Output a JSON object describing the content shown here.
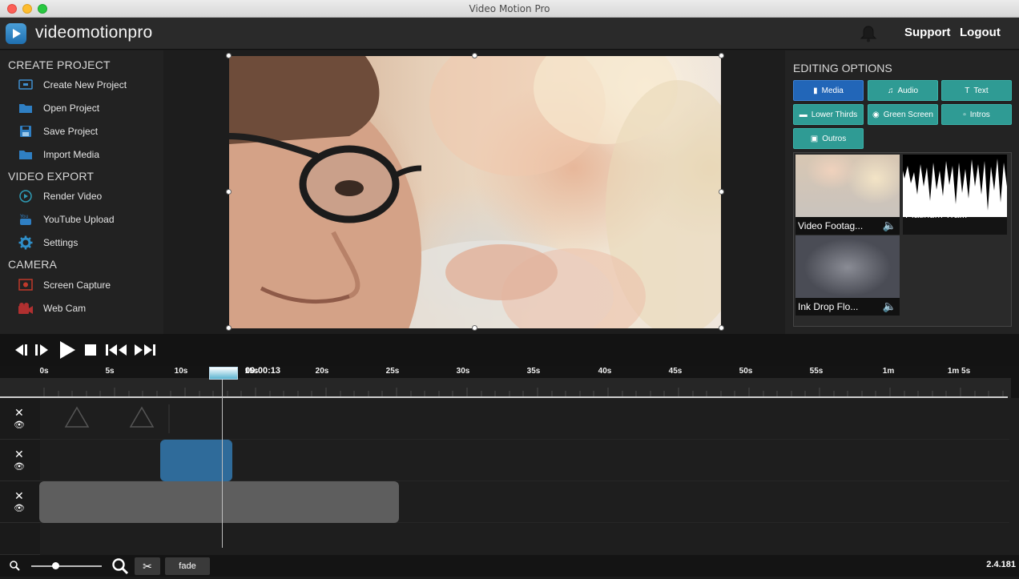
{
  "window": {
    "title": "Video Motion Pro"
  },
  "app": {
    "brand": "videomotionpro",
    "support_label": "Support",
    "logout_label": "Logout"
  },
  "sidebar": {
    "create_title": "CREATE PROJECT",
    "export_title": "VIDEO EXPORT",
    "camera_title": "CAMERA",
    "items": [
      {
        "label": "Create New Project",
        "icon": "new-project-icon"
      },
      {
        "label": "Open Project",
        "icon": "folder-open-icon"
      },
      {
        "label": "Save Project",
        "icon": "save-icon"
      },
      {
        "label": "Import Media",
        "icon": "folder-icon"
      },
      {
        "label": "Render Video",
        "icon": "render-icon"
      },
      {
        "label": "YouTube Upload",
        "icon": "youtube-icon"
      },
      {
        "label": "Settings",
        "icon": "gear-icon"
      },
      {
        "label": "Screen Capture",
        "icon": "screen-capture-icon"
      },
      {
        "label": "Web Cam",
        "icon": "webcam-icon"
      }
    ]
  },
  "editing": {
    "title": "EDITING OPTIONS",
    "tabs": [
      {
        "label": "Media",
        "active": true
      },
      {
        "label": "Audio",
        "active": false
      },
      {
        "label": "Text",
        "active": false
      },
      {
        "label": "Lower Thirds",
        "active": false
      },
      {
        "label": "Green Screen",
        "active": false
      },
      {
        "label": "Intros",
        "active": false
      },
      {
        "label": "Outros",
        "active": false
      }
    ],
    "media": [
      {
        "name": "Video Footag..."
      },
      {
        "name": "Platinum Tra..."
      },
      {
        "name": "Ink Drop Flo..."
      }
    ]
  },
  "timeline": {
    "current_time": "00:00:13",
    "ticks": [
      "0s",
      "5s",
      "10s",
      "15s",
      "20s",
      "25s",
      "30s",
      "35s",
      "40s",
      "45s",
      "50s",
      "55s",
      "1m",
      "1m 5s"
    ]
  },
  "bottom": {
    "fade_label": "fade",
    "version": "2.4.181"
  },
  "colors": {
    "accent_teal": "#2f9b94",
    "accent_blue": "#2266b8",
    "clip_blue": "#2f6b9a",
    "clip_gray": "#5e5e5e"
  }
}
